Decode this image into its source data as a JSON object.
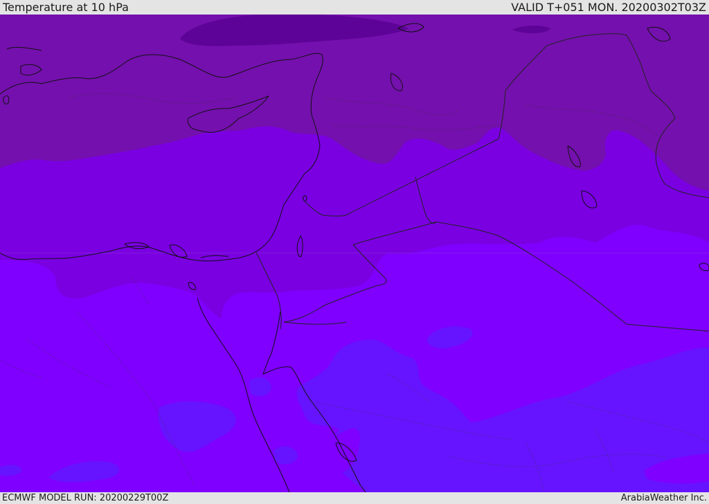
{
  "header": {
    "title": "Temperature at 10 hPa",
    "valid_time": "VALID T+051 MON. 20200302T03Z"
  },
  "footer": {
    "model_run": "ECMWF MODEL RUN: 20200229T00Z",
    "credit": "ArabiaWeather Inc."
  },
  "map": {
    "variable": "temperature",
    "level_hpa": 10,
    "colors": {
      "band_darkest": "#5e0398",
      "band_dark": "#7410ad",
      "band_mid": "#7a00e2",
      "band_light": "#7f00ff",
      "band_blue": "#6614ff",
      "coastline": "#111111",
      "border": "#222222"
    }
  }
}
